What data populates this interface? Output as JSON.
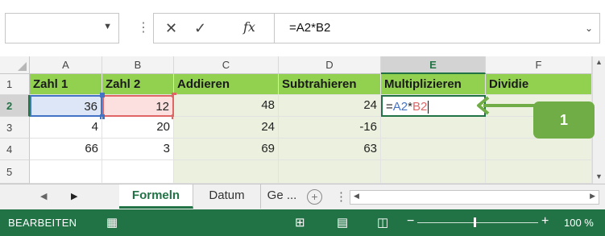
{
  "formula_bar": {
    "name_box_value": "",
    "cancel_symbol": "✕",
    "enter_symbol": "✓",
    "fx_label": "fx",
    "formula": "=A2*B2"
  },
  "columns": [
    "A",
    "B",
    "C",
    "D",
    "E",
    "F"
  ],
  "rows": [
    "1",
    "2",
    "3",
    "4",
    "5"
  ],
  "cells": {
    "r1": [
      "Zahl 1",
      "Zahl 2",
      "Addieren",
      "Subtrahieren",
      "Multiplizieren",
      "Dividie"
    ],
    "r2": [
      "36",
      "12",
      "48",
      "24"
    ],
    "r3": [
      "4",
      "20",
      "24",
      "-16"
    ],
    "r4": [
      "66",
      "3",
      "69",
      "63"
    ]
  },
  "editing_cell": {
    "prefix": "=",
    "ref1": "A2",
    "op": "*",
    "ref2": "B2"
  },
  "callout": {
    "label": "1"
  },
  "sheet_tabs": [
    "Formeln",
    "Datum",
    "Ge ..."
  ],
  "status_bar": {
    "mode": "BEARBEITEN",
    "zoom": "100 %"
  },
  "colors": {
    "accent": "#217346",
    "header_fill": "#92d050",
    "light_green": "#ebf1de",
    "ref_blue": "#4472c4",
    "ref_red": "#e06666",
    "callout": "#70ad47"
  }
}
